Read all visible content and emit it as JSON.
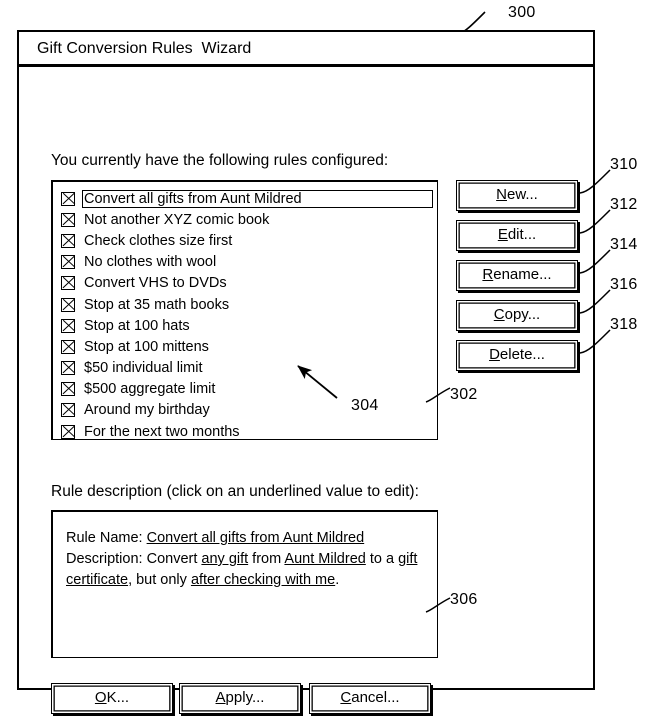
{
  "figure": {
    "window_ref": "300",
    "listbox_ref": "302",
    "list_pointer_ref": "304",
    "description_ref": "306",
    "button_refs": [
      "310",
      "312",
      "314",
      "316",
      "318"
    ]
  },
  "window": {
    "title": "Gift Conversion Rules  Wizard"
  },
  "rules_section": {
    "label": "You currently have the following rules configured:",
    "items": [
      {
        "label": "Convert all gifts from Aunt Mildred",
        "checked": true,
        "selected": true
      },
      {
        "label": "Not another XYZ comic book",
        "checked": true,
        "selected": false
      },
      {
        "label": "Check clothes size first",
        "checked": true,
        "selected": false
      },
      {
        "label": "No clothes with wool",
        "checked": true,
        "selected": false
      },
      {
        "label": "Convert VHS to DVDs",
        "checked": true,
        "selected": false
      },
      {
        "label": "Stop at 35 math books",
        "checked": true,
        "selected": false
      },
      {
        "label": "Stop at 100 hats",
        "checked": true,
        "selected": false
      },
      {
        "label": "Stop at 100 mittens",
        "checked": true,
        "selected": false
      },
      {
        "label": "$50 individual limit",
        "checked": true,
        "selected": false
      },
      {
        "label": "$500 aggregate limit",
        "checked": true,
        "selected": false
      },
      {
        "label": "Around my birthday",
        "checked": true,
        "selected": false
      },
      {
        "label": "For the next two months",
        "checked": true,
        "selected": false
      }
    ]
  },
  "side_buttons": [
    {
      "mnemonic": "N",
      "rest": "ew...",
      "ref": "310"
    },
    {
      "mnemonic": "E",
      "rest": "dit...",
      "ref": "312"
    },
    {
      "mnemonic": "R",
      "rest": "ename...",
      "ref": "314"
    },
    {
      "mnemonic": "C",
      "rest": "opy...",
      "ref": "316"
    },
    {
      "mnemonic": "D",
      "rest": "elete...",
      "ref": "318"
    }
  ],
  "description_section": {
    "label": "Rule description (click on an underlined value to edit):",
    "rule_name_label": "Rule Name: ",
    "rule_name_value": "Convert all gifts from Aunt Mildred",
    "description_label": "Description: ",
    "desc_part1": "Convert ",
    "desc_link1": "any gift",
    "desc_part2": " from ",
    "desc_link2": "Aunt Mildred",
    "desc_part3": " to a ",
    "desc_link3": "gift certificate",
    "desc_part4": ", but only ",
    "desc_link4": "after checking with me",
    "desc_part5": "."
  },
  "footer_buttons": [
    {
      "mnemonic": "O",
      "rest": "K..."
    },
    {
      "mnemonic": "A",
      "rest": "pply..."
    },
    {
      "mnemonic": "C",
      "rest": "ancel..."
    }
  ]
}
